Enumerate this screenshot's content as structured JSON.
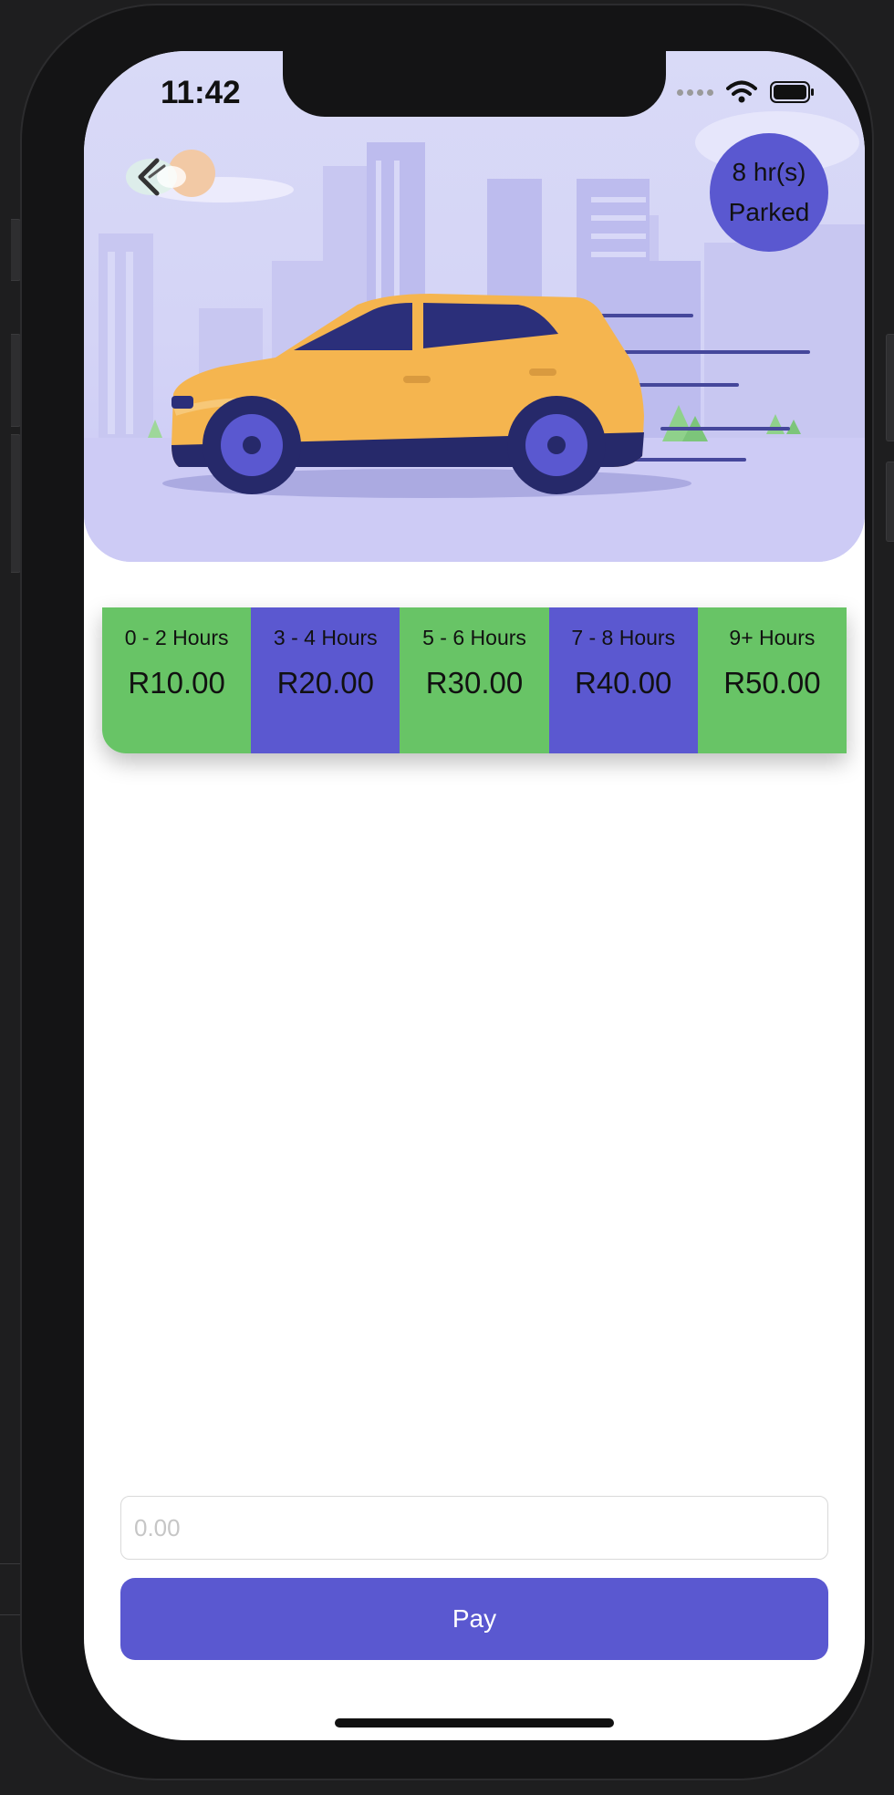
{
  "status_bar": {
    "time": "11:42"
  },
  "header": {
    "parked_hours": "8 hr(s)",
    "parked_label": "Parked"
  },
  "rates": [
    {
      "label": "0 - 2 Hours",
      "price": "R10.00",
      "color": "#68c466"
    },
    {
      "label": "3 - 4 Hours",
      "price": "R20.00",
      "color": "#5b58d0"
    },
    {
      "label": "5 - 6 Hours",
      "price": "R30.00",
      "color": "#68c466"
    },
    {
      "label": "7 - 8 Hours",
      "price": "R40.00",
      "color": "#5b58d0"
    },
    {
      "label": "9+ Hours",
      "price": "R50.00",
      "color": "#68c466"
    }
  ],
  "payment": {
    "amount_value": "",
    "amount_placeholder": "0.00",
    "pay_label": "Pay"
  },
  "icons": {
    "back": "back-chevron-icon",
    "wifi": "wifi-icon",
    "battery": "battery-icon",
    "signal": "signal-icon"
  },
  "colors": {
    "accent": "#5a58d0",
    "green": "#68c466",
    "hero_background": "#d4d4f6",
    "car": "#f5b54f"
  }
}
